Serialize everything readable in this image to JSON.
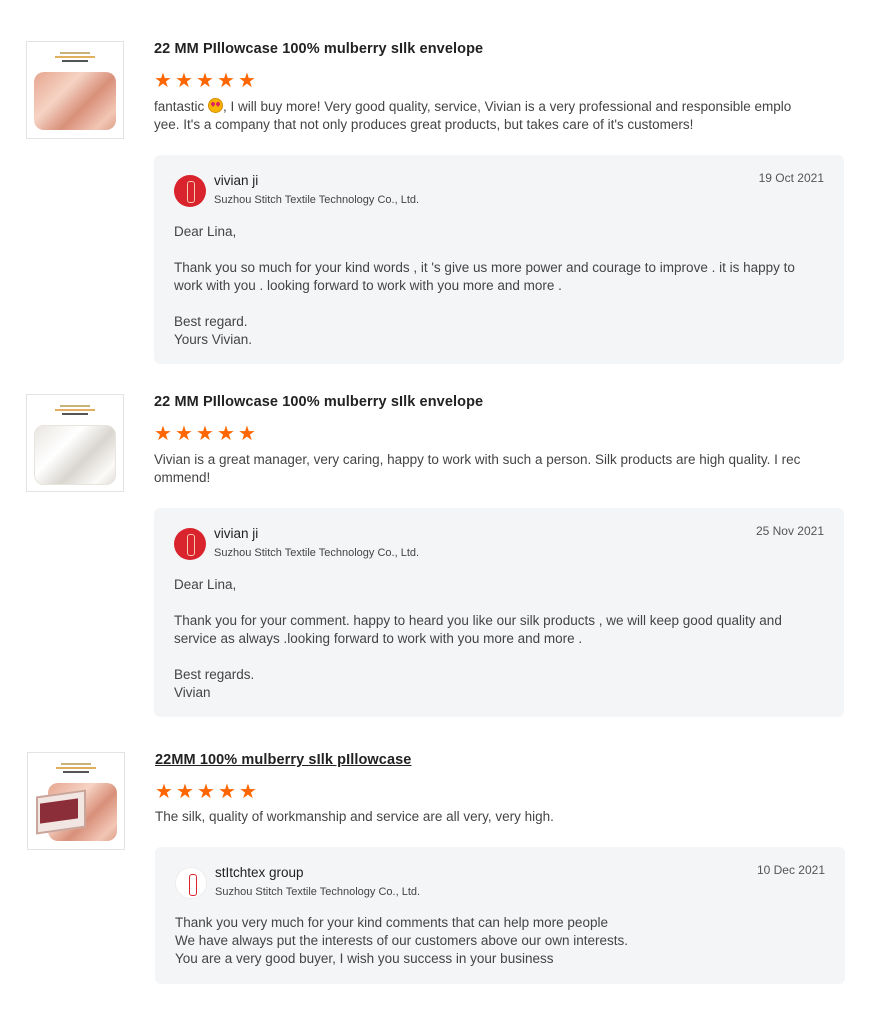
{
  "reviews": [
    {
      "product_title": "22 MM PIllowcase 100% mulberry sIlk envelope",
      "rating": 5,
      "comment_prefix": "fantastic ",
      "comment_emoji": "star-struck-emoji",
      "comment_line1": ", I will buy more! Very good quality, service, Vivian is a very professional and responsible emplo",
      "comment_line2": "yee. It's a company that not only produces great products, but takes care of it's customers!",
      "reply": {
        "name": "vivian ji",
        "company": "Suzhou Stitch Textile Technology Co., Ltd.",
        "date": "19 Oct 2021",
        "lines": [
          "Dear Lina,",
          "",
          "Thank you so much for your kind words , it 's give us more power and courage to improve . it is happy to",
          "work with you . looking forward to work with you more and more .",
          "",
          "Best regard.",
          "Yours Vivian."
        ]
      }
    },
    {
      "product_title": "22 MM PIllowcase 100% mulberry sIlk envelope",
      "rating": 5,
      "comment_line1": "Vivian is a great manager, very caring, happy to work with such a person. Silk products are high quality. I rec",
      "comment_line2": "ommend!",
      "reply": {
        "name": "vivian ji",
        "company": "Suzhou Stitch Textile Technology Co., Ltd.",
        "date": "25 Nov 2021",
        "lines": [
          "Dear Lina,",
          "",
          "Thank you for your comment. happy to heard you like our silk products , we will keep good quality and",
          "service as always .looking forward to work with you more and more .",
          "",
          "Best regards.",
          "Vivian"
        ]
      }
    },
    {
      "product_title": "22MM 100% mulberry sIlk pIllowcase",
      "rating": 5,
      "comment_line1": "The silk, quality of workmanship and service are all very, very high.",
      "reply": {
        "name": "stItchtex group",
        "company": "Suzhou Stitch Textile Technology Co., Ltd.",
        "date": "10 Dec 2021",
        "lines": [
          "Thank you very much for your kind comments that can help more people",
          "We have always put the interests of our customers above our own interests.",
          "You are a very good buyer, I wish you success in your business"
        ]
      }
    }
  ],
  "colors": {
    "star": "#ff6600",
    "reply_bg": "#f4f5f7",
    "avatar_red": "#d9232d"
  },
  "icons": {
    "star": "star-icon",
    "avatar": "company-logo-avatar"
  }
}
